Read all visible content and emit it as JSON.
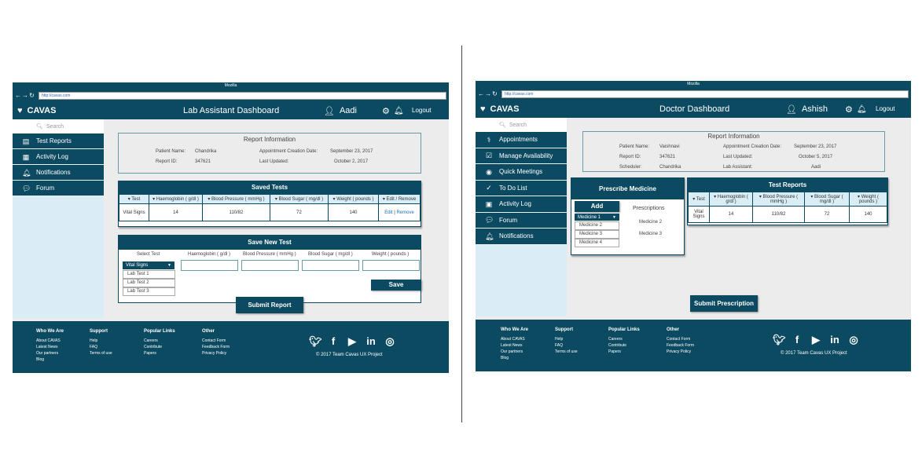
{
  "left": {
    "titlebar": "Mozilla",
    "url": "http://cavas.com",
    "brand": "CAVAS",
    "dashboard_title": "Lab Assistant Dashboard",
    "user": "Aadi",
    "logout": "Logout",
    "search_placeholder": "Search",
    "sidebar": [
      "Test Reports",
      "Activity Log",
      "Notifications",
      "Forum"
    ],
    "report": {
      "title": "Report Information",
      "patient_label": "Patient Name:",
      "patient": "Chandrika",
      "report_label": "Report ID:",
      "report_id": "347621",
      "created_label": "Appointment Creation Date:",
      "created": "September 23, 2017",
      "updated_label": "Last Updated:",
      "updated": "October 2, 2017"
    },
    "saved_tests": {
      "title": "Saved Tests",
      "headers": [
        "▾ Test",
        "▾ Haemoglobin ( g/dl )",
        "▾ Blood Pressure ( mmHg )",
        "▾ Blood Sugar ( mg/dl )",
        "▾ Weight ( pounds )",
        "▾ Edit / Remove"
      ],
      "row": {
        "test": "Vital Signs",
        "hb": "14",
        "bp": "110/82",
        "sugar": "72",
        "weight": "140",
        "edit": "Edit",
        "sep": " | ",
        "remove": "Remove"
      }
    },
    "new_test": {
      "title": "Save New Test",
      "headers": [
        "Select Test",
        "Haemoglobin ( g/dl )",
        "Blood Pressure ( mmHg )",
        "Blood Sugar ( mg/dl )",
        "Weight ( pounds )"
      ],
      "selected": "Vital Signs",
      "options": [
        "Lab Test 1",
        "Lab Test 2",
        "Lab Test 3"
      ],
      "save": "Save"
    },
    "submit": "Submit Report"
  },
  "right": {
    "titlebar": "Mozilla",
    "url": "http://cavas.com",
    "brand": "CAVAS",
    "dashboard_title": "Doctor Dashboard",
    "user": "Ashish",
    "logout": "Logout",
    "search_placeholder": "Search",
    "sidebar": [
      "Appointments",
      "Manage Availability",
      "Quick Meetings",
      "To Do List",
      "Activity Log",
      "Forum",
      "Notifications"
    ],
    "report": {
      "title": "Report Information",
      "patient_label": "Patient Name:",
      "patient": "Vaishnavi",
      "report_label": "Report ID:",
      "report_id": "347621",
      "scheduler_label": "Scheduler:",
      "scheduler": "Chandrika",
      "created_label": "Appointment Creation Date:",
      "created": "September 23, 2017",
      "updated_label": "Last Updated:",
      "updated": "October 5, 2017",
      "assistant_label": "Lab Assistant:",
      "assistant": "Aadi"
    },
    "prescribe": {
      "title": "Prescribe Medicine",
      "add": "Add",
      "selected": "Medicine 1",
      "options": [
        "Medicine 2",
        "Medicine 3",
        "Medicine 4"
      ],
      "prescriptions_title": "Prescriptions",
      "prescriptions": [
        "Medicine 2",
        "Medicine 3"
      ]
    },
    "test_reports": {
      "title": "Test Reports",
      "headers": [
        "▾ Test",
        "▾ Haemoglobin ( g/dl )",
        "▾ Blood Pressure ( mmHg )",
        "▾ Blood Sugar ( mg/dl )",
        "▾ Weight ( pounds )"
      ],
      "row": {
        "test": "Vital Signs",
        "hb": "14",
        "bp": "110/82",
        "sugar": "72",
        "weight": "140"
      }
    },
    "submit": "Submit Prescription"
  },
  "footer": {
    "who": {
      "title": "Who We Are",
      "items": [
        "About CAVAS",
        "Latest News",
        "Our partners",
        "Blog"
      ]
    },
    "support": {
      "title": "Support",
      "items": [
        "Help",
        "FAQ",
        "Terms of use"
      ]
    },
    "popular": {
      "title": "Popular Links",
      "items": [
        "Careers",
        "Contribute",
        "Papers"
      ]
    },
    "other": {
      "title": "Other",
      "items": [
        "Contact Form",
        "Feedback Form",
        "Privacy Policy"
      ]
    },
    "copyright": "© 2017 Team Cavas UX Project"
  },
  "colors": {
    "primary": "#0c4a61",
    "sidebar": "#daedf7",
    "content": "#ececec"
  }
}
